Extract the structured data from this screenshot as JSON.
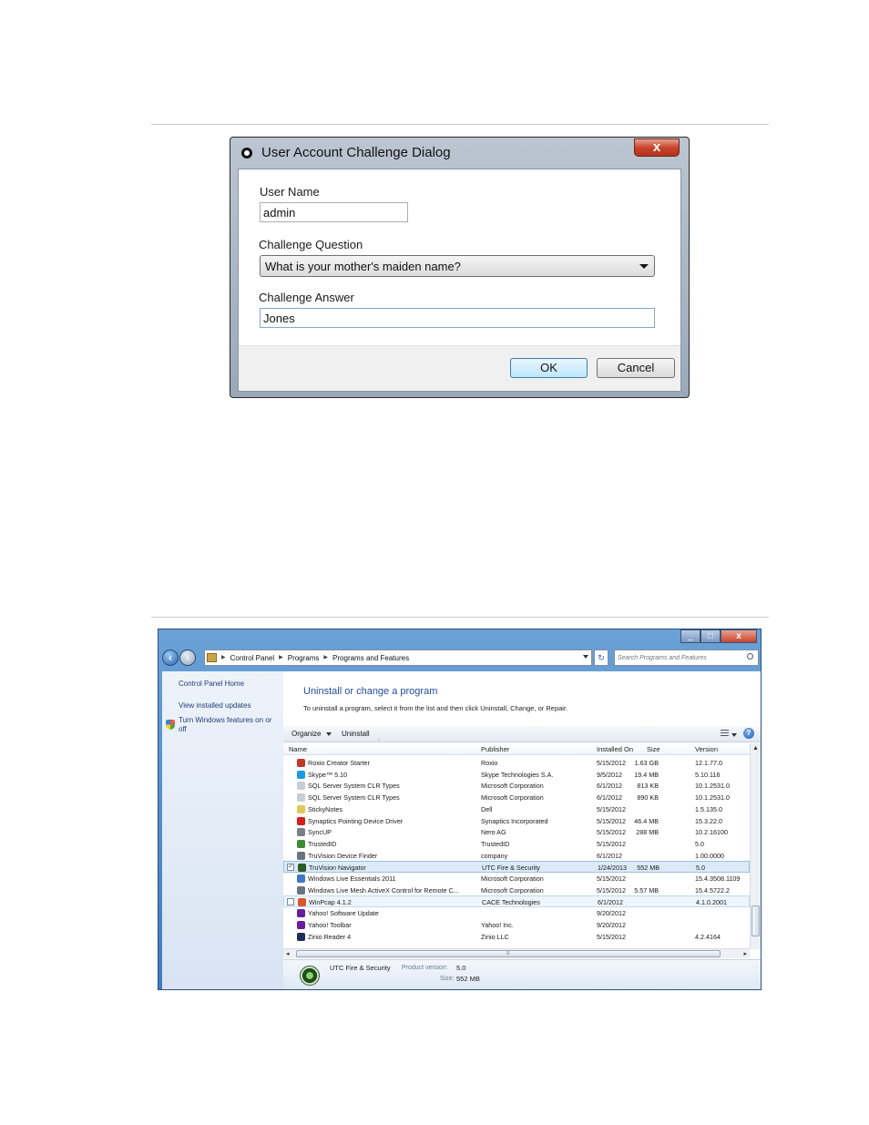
{
  "dialog": {
    "title": "User Account Challenge Dialog",
    "close_label": "x",
    "user_name_label": "User Name",
    "user_name_value": "admin",
    "challenge_question_label": "Challenge Question",
    "challenge_question_value": "What is your mother's maiden name?",
    "challenge_answer_label": "Challenge Answer",
    "challenge_answer_value": "Jones",
    "ok_label": "OK",
    "cancel_label": "Cancel"
  },
  "window": {
    "minimize_label": "_",
    "maximize_label": "□",
    "close_label": "x",
    "breadcrumbs": [
      "Control Panel",
      "Programs",
      "Programs and Features"
    ],
    "search_placeholder": "Search Programs and Features",
    "sidebar": {
      "home": "Control Panel Home",
      "updates": "View installed updates",
      "features_line1": "Turn Windows features on or",
      "features_line2": "off"
    },
    "heading": "Uninstall or change a program",
    "subheading": "To uninstall a program, select it from the list and then click Uninstall, Change, or Repair.",
    "toolbar": {
      "organize": "Organize",
      "uninstall": "Uninstall",
      "help": "?"
    },
    "columns": {
      "name": "Name",
      "publisher": "Publisher",
      "installed_on": "Installed On",
      "size": "Size",
      "version": "Version"
    },
    "programs": [
      {
        "name": "Roxio Creator Starter",
        "publisher": "Roxio",
        "installed": "5/15/2012",
        "size": "1.63 GB",
        "version": "12.1.77.0",
        "icon_color": "#c0392b"
      },
      {
        "name": "Skype™ 5.10",
        "publisher": "Skype Technologies S.A.",
        "installed": "9/5/2012",
        "size": "19.4 MB",
        "version": "5.10.116",
        "icon_color": "#1e9be0"
      },
      {
        "name": "SQL Server System CLR Types",
        "publisher": "Microsoft Corporation",
        "installed": "6/1/2012",
        "size": "813 KB",
        "version": "10.1.2531.0",
        "icon_color": "#c8ced6"
      },
      {
        "name": "SQL Server System CLR Types",
        "publisher": "Microsoft Corporation",
        "installed": "6/1/2012",
        "size": "890 KB",
        "version": "10.1.2531.0",
        "icon_color": "#c8ced6"
      },
      {
        "name": "StickyNotes",
        "publisher": "Dell",
        "installed": "5/15/2012",
        "size": "",
        "version": "1.5.135.0",
        "icon_color": "#e3c75a"
      },
      {
        "name": "Synaptics Pointing Device Driver",
        "publisher": "Synaptics Incorporated",
        "installed": "5/15/2012",
        "size": "46.4 MB",
        "version": "15.3.22.0",
        "icon_color": "#d11f1f"
      },
      {
        "name": "SyncUP",
        "publisher": "Nero AG",
        "installed": "5/15/2012",
        "size": "288 MB",
        "version": "10.2.16100",
        "icon_color": "#7a8088"
      },
      {
        "name": "TrustedID",
        "publisher": "TrustedID",
        "installed": "5/15/2012",
        "size": "",
        "version": "5.0",
        "icon_color": "#3c8a34"
      },
      {
        "name": "TruVision Device Finder",
        "publisher": "company",
        "installed": "6/1/2012",
        "size": "",
        "version": "1.00.0000",
        "icon_color": "#6a7480"
      },
      {
        "name": "TruVision Navigator",
        "publisher": "UTC Fire & Security",
        "installed": "1/24/2013",
        "size": "552 MB",
        "version": "5.0",
        "icon_color": "#2d5a25"
      },
      {
        "name": "Windows Live Essentials 2011",
        "publisher": "Microsoft Corporation",
        "installed": "5/15/2012",
        "size": "",
        "version": "15.4.3508.1109",
        "icon_color": "#3f78c8"
      },
      {
        "name": "Windows Live Mesh ActiveX Control for Remote C...",
        "publisher": "Microsoft Corporation",
        "installed": "5/15/2012",
        "size": "5.57 MB",
        "version": "15.4.5722.2",
        "icon_color": "#6a7480"
      },
      {
        "name": "WinPcap 4.1.2",
        "publisher": "CACE Technologies",
        "installed": "6/1/2012",
        "size": "",
        "version": "4.1.0.2001",
        "icon_color": "#d9572e"
      },
      {
        "name": "Yahoo! Software Update",
        "publisher": "",
        "installed": "9/20/2012",
        "size": "",
        "version": "",
        "icon_color": "#6a1f9a"
      },
      {
        "name": "Yahoo! Toolbar",
        "publisher": "Yahoo! Inc.",
        "installed": "9/20/2012",
        "size": "",
        "version": "",
        "icon_color": "#6a1f9a"
      },
      {
        "name": "Zinio Reader 4",
        "publisher": "Zinio LLC",
        "installed": "5/15/2012",
        "size": "",
        "version": "4.2.4164",
        "icon_color": "#1f2f55"
      }
    ],
    "selected_row": "TruVision Navigator",
    "details": {
      "publisher": "UTC Fire & Security",
      "product_version_label": "Product version:",
      "product_version": "5.0",
      "size_label": "Size:",
      "size": "552 MB"
    }
  }
}
